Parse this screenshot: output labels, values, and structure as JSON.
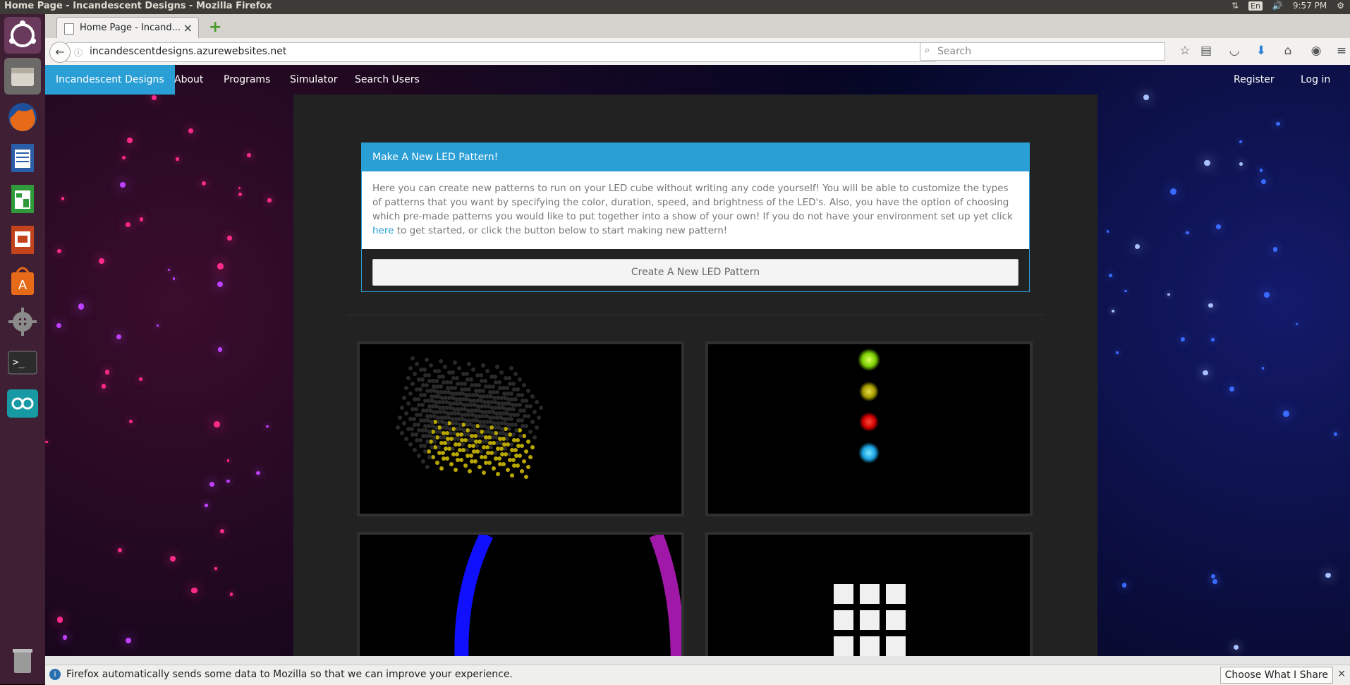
{
  "system": {
    "window_title": "Home Page - Incandescent Designs - Mozilla Firefox",
    "language": "En",
    "time": "9:57 PM"
  },
  "launcher": {
    "apps": [
      "ubuntu-dash",
      "files",
      "firefox",
      "writer",
      "calc",
      "impress",
      "software-center",
      "system-settings",
      "terminal",
      "arduino",
      "trash"
    ]
  },
  "browser": {
    "tab_title": "Home Page - Incand...",
    "url": "incandescentdesigns.azurewebsites.net",
    "search_placeholder": "Search"
  },
  "site": {
    "brand": "Incandescent Designs",
    "nav": [
      "About",
      "Programs",
      "Simulator",
      "Search Users"
    ],
    "nav_right": [
      "Register",
      "Log in"
    ]
  },
  "panel": {
    "heading": "Make A New LED Pattern!",
    "body_before_link": "Here you can create new patterns to run on your LED cube without writing any code yourself! You will be able to customize the types of patterns that you want by specifying the color, duration, speed, and brightness of the LED's. Also, you have the option of choosing which pre-made patterns you would like to put together into a show of your own! If you do not have your environment set up yet click",
    "link_text": "here",
    "body_after_link": "to get started, or click the button below to start making new pattern!",
    "button": "Create A New LED Pattern"
  },
  "notification": {
    "text": "Firefox automatically sends some data to Mozilla so that we can improve your experience.",
    "button": "Choose What I Share"
  }
}
